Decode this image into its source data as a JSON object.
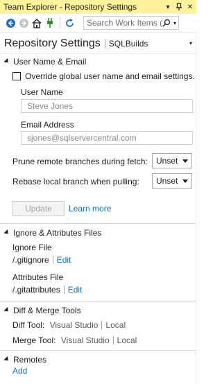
{
  "window": {
    "title": "Team Explorer - Repository Settings",
    "dropdown_glyph": "▾",
    "pin_glyph": "⊓",
    "close_glyph": "✕"
  },
  "toolbar": {
    "search_placeholder": "Search Work Items (C",
    "icons": [
      "back-arrow-icon",
      "forward-arrow-icon",
      "home-icon",
      "connect-plug-icon",
      "refresh-icon"
    ]
  },
  "page": {
    "title": "Repository Settings",
    "subtitle": "SQLBuilds"
  },
  "user_section": {
    "title": "User Name & Email",
    "override_label": "Override global user name and email settings.",
    "override_checked": false,
    "username_label": "User Name",
    "username_value": "Steve Jones",
    "email_label": "Email Address",
    "email_value": "sjones@sqlservercentral.com",
    "prune_label": "Prune remote branches during fetch:",
    "prune_value": "Unset",
    "rebase_label": "Rebase local branch when pulling:",
    "rebase_value": "Unset",
    "update_button": "Update",
    "learn_more": "Learn more"
  },
  "ignore_section": {
    "title": "Ignore & Attributes Files",
    "ignore_label": "Ignore File",
    "ignore_path": "/.gitignore",
    "ignore_edit": "Edit",
    "attributes_label": "Attributes File",
    "attributes_path": "/.gitattributes",
    "attributes_edit": "Edit"
  },
  "diff_section": {
    "title": "Diff & Merge Tools",
    "diff_label": "Diff Tool:",
    "diff_option1": "Visual Studio",
    "diff_option2": "Local",
    "merge_label": "Merge Tool:",
    "merge_option1": "Visual Studio",
    "merge_option2": "Local"
  },
  "remotes_section": {
    "title": "Remotes",
    "add_link": "Add"
  },
  "colors": {
    "titlebar_bg": "#fff29d",
    "link": "#0e70c0",
    "plug_green": "#388a34",
    "nav_blue": "#1e6fc5"
  }
}
